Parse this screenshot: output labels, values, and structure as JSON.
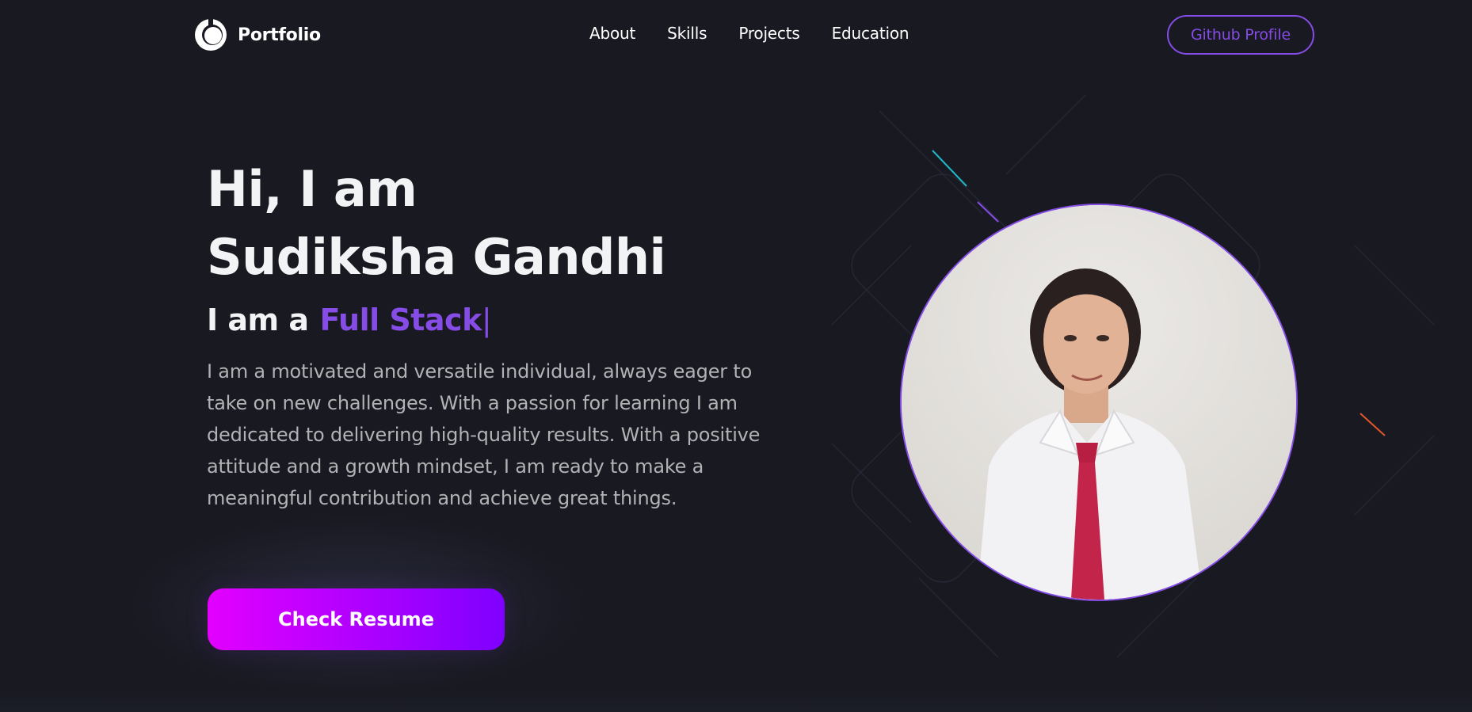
{
  "navbar": {
    "logo_text": "Portfolio",
    "logo_icon": "portfolio-logo-icon",
    "links": [
      {
        "label": "About"
      },
      {
        "label": "Skills"
      },
      {
        "label": "Projects"
      },
      {
        "label": "Education"
      }
    ],
    "github_button": "Github Profile"
  },
  "hero": {
    "title_line1": "Hi, I am",
    "title_line2": "Sudiksha Gandhi",
    "role_prefix": "I am a",
    "role_typed": "Full Stack",
    "cursor": "|",
    "description": "I am a motivated and versatile individual, always eager to take on new challenges. With a passion for learning I am dedicated to delivering high-quality results. With a positive attitude and a growth mindset, I am ready to make a meaningful contribution and achieve great things.",
    "resume_button": "Check Resume"
  },
  "colors": {
    "background": "#191922",
    "accent": "#854ce6",
    "text_primary": "#f2f3f4",
    "text_secondary": "#b1b2b3",
    "button_gradient_start": "#e300ff",
    "button_gradient_end": "#7f00ff"
  }
}
